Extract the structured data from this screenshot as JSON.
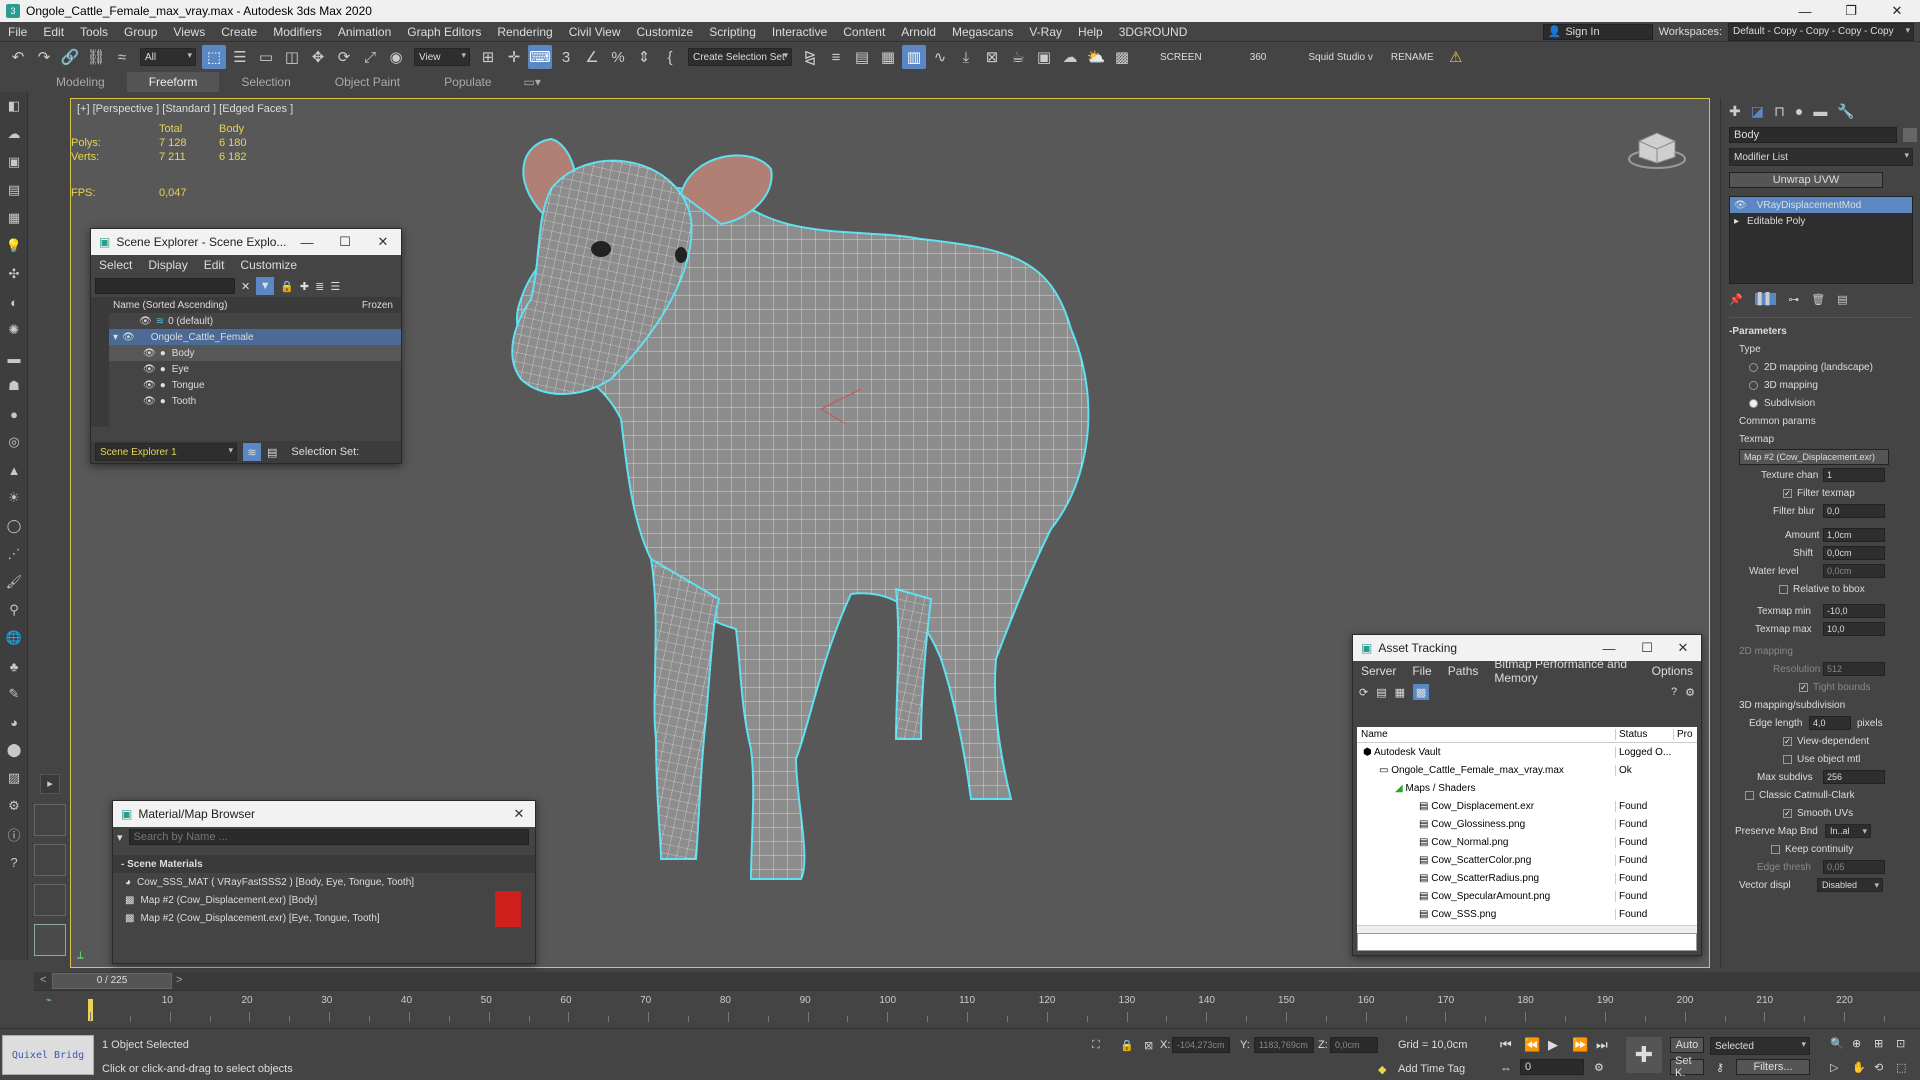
{
  "window": {
    "title": "Ongole_Cattle_Female_max_vray.max - Autodesk 3ds Max 2020",
    "minimize_icon": "minimize-icon",
    "maximize_icon": "maximize-icon",
    "close_icon": "close-icon"
  },
  "menu": {
    "items": [
      "File",
      "Edit",
      "Tools",
      "Group",
      "Views",
      "Create",
      "Modifiers",
      "Animation",
      "Graph Editors",
      "Rendering",
      "Civil View",
      "Customize",
      "Scripting",
      "Interactive",
      "Content",
      "Arnold",
      "Megascans",
      "V-Ray",
      "Help",
      "3DGROUND"
    ],
    "sign_in": "Sign In",
    "workspaces_label": "Workspaces:",
    "workspace_value": "Default - Copy - Copy - Copy - Copy"
  },
  "toolbar": {
    "selection_filter": "All",
    "ref_coord": "View",
    "selection_set": "Create Selection Set",
    "screen_label": "SCREEN",
    "angle_value": "360",
    "studio_label": "Squid Studio v",
    "rename_label": "RENAME"
  },
  "ribbon": {
    "tabs": [
      "Modeling",
      "Freeform",
      "Selection",
      "Object Paint",
      "Populate"
    ],
    "active": "Freeform"
  },
  "viewport": {
    "label": "[+] [Perspective ] [Standard ] [Edged Faces ]",
    "stats": {
      "total_header": "Total",
      "body_header": "Body",
      "polys_label": "Polys:",
      "polys_total": "7 128",
      "polys_body": "6 180",
      "verts_label": "Verts:",
      "verts_total": "7 211",
      "verts_body": "6 182",
      "fps_label": "FPS:",
      "fps_value": "0,047"
    }
  },
  "scene_explorer": {
    "title": "Scene Explorer - Scene Explo...",
    "menu": [
      "Select",
      "Display",
      "Edit",
      "Customize"
    ],
    "col_name": "Name (Sorted Ascending)",
    "col_frozen": "Frozen",
    "rows": [
      {
        "label": "0 (default)",
        "indent": 1
      },
      {
        "label": "Ongole_Cattle_Female",
        "indent": 1
      },
      {
        "label": "Body",
        "indent": 2
      },
      {
        "label": "Eye",
        "indent": 2
      },
      {
        "label": "Tongue",
        "indent": 2
      },
      {
        "label": "Tooth",
        "indent": 2
      }
    ],
    "footer_name": "Scene Explorer 1",
    "footer_selection": "Selection Set:"
  },
  "material_browser": {
    "title": "Material/Map Browser",
    "search_placeholder": "Search by Name ...",
    "section": "- Scene Materials",
    "items": [
      "Cow_SSS_MAT  ( VRayFastSSS2 )  [Body, Eye, Tongue, Tooth]",
      "Map #2 (Cow_Displacement.exr)  [Body]",
      "Map #2 (Cow_Displacement.exr)  [Eye, Tongue, Tooth]"
    ]
  },
  "asset_tracking": {
    "title": "Asset Tracking",
    "menu": [
      "Server",
      "File",
      "Paths",
      "Bitmap Performance and Memory",
      "Options"
    ],
    "col_name": "Name",
    "col_status": "Status",
    "col_pro": "Pro",
    "rows": [
      {
        "name": "Autodesk Vault",
        "status": "Logged O...",
        "indent": 0
      },
      {
        "name": "Ongole_Cattle_Female_max_vray.max",
        "status": "Ok",
        "indent": 1
      },
      {
        "name": "Maps / Shaders",
        "status": "",
        "indent": 2
      },
      {
        "name": "Cow_Displacement.exr",
        "status": "Found",
        "indent": 3
      },
      {
        "name": "Cow_Glossiness.png",
        "status": "Found",
        "indent": 3
      },
      {
        "name": "Cow_Normal.png",
        "status": "Found",
        "indent": 3
      },
      {
        "name": "Cow_ScatterColor.png",
        "status": "Found",
        "indent": 3
      },
      {
        "name": "Cow_ScatterRadius.png",
        "status": "Found",
        "indent": 3
      },
      {
        "name": "Cow_SpecularAmount.png",
        "status": "Found",
        "indent": 3
      },
      {
        "name": "Cow_SSS.png",
        "status": "Found",
        "indent": 3
      }
    ]
  },
  "command_panel": {
    "object_name": "Body",
    "modifier_list": "Modifier List",
    "unwrap": "Unwrap UVW",
    "stack": [
      "VRayDisplacementMod",
      "Editable Poly"
    ],
    "params_header": "Parameters",
    "type_label": "Type",
    "type_options": [
      "2D mapping (landscape)",
      "3D mapping",
      "Subdivision"
    ],
    "common_params": "Common params",
    "texmap_label": "Texmap",
    "texmap_value": "Map #2 (Cow_Displacement.exr)",
    "texture_chan_label": "Texture chan",
    "texture_chan_value": "1",
    "filter_texmap": "Filter texmap",
    "filter_blur_label": "Filter blur",
    "filter_blur_value": "0,0",
    "amount_label": "Amount",
    "amount_value": "1,0cm",
    "shift_label": "Shift",
    "shift_value": "0,0cm",
    "water_label": "Water level",
    "water_value": "0,0cm",
    "relative_bbox": "Relative to bbox",
    "texmap_min_label": "Texmap min",
    "texmap_min_value": "-10,0",
    "texmap_max_label": "Texmap max",
    "texmap_max_value": "10,0",
    "mapping2d_header": "2D mapping",
    "resolution_label": "Resolution",
    "resolution_value": "512",
    "tight_bounds": "Tight bounds",
    "mapping3d_header": "3D mapping/subdivision",
    "edge_length_label": "Edge length",
    "edge_length_value": "4,0",
    "pixels_label": "pixels",
    "view_dependent": "View-dependent",
    "use_object_mtl": "Use object mtl",
    "max_subdivs_label": "Max subdivs",
    "max_subdivs_value": "256",
    "classic_catmull": "Classic Catmull-Clark",
    "smooth_uvs": "Smooth UVs",
    "preserve_label": "Preserve Map Bnd",
    "preserve_value": "In..al",
    "keep_continuity": "Keep continuity",
    "edge_thresh_label": "Edge thresh",
    "edge_thresh_value": "0,05",
    "vector_displ_label": "Vector displ",
    "vector_displ_value": "Disabled"
  },
  "timeline": {
    "frame": "0 / 225",
    "ticks": [
      0,
      5,
      10,
      15,
      20,
      25,
      30,
      35,
      40,
      45,
      50,
      55,
      60,
      65,
      70,
      75,
      80,
      85,
      90,
      95,
      100,
      105,
      110,
      115,
      120,
      125,
      130,
      135,
      140,
      145,
      150,
      155,
      160,
      165,
      170,
      175,
      180,
      185,
      190,
      195,
      200,
      205,
      210,
      215,
      220,
      225
    ],
    "labels": [
      10,
      20,
      30,
      40,
      50,
      60,
      70,
      80,
      90,
      100,
      110,
      120,
      130,
      140,
      150,
      160,
      170,
      180,
      190,
      200,
      210,
      220
    ]
  },
  "status": {
    "selected": "1 Object Selected",
    "prompt": "Click or click-and-drag to select objects",
    "x_label": "X:",
    "x_value": "-104,273cm",
    "y_label": "Y:",
    "y_value": "1183,769cm",
    "z_label": "Z:",
    "z_value": "0,0cm",
    "grid": "Grid = 10,0cm",
    "add_time_tag": "Add Time Tag",
    "auto": "Auto",
    "set_k": "Set K.",
    "selected_dd": "Selected",
    "filters": "Filters...",
    "frame_value": "0",
    "bridge_label": "Quixel Bridg"
  },
  "colors": {
    "accent": "#5b88c4",
    "selection_outline": "#5fe0f0",
    "stat_yellow": "#e8d44d",
    "viewport_bg": "#585858"
  }
}
